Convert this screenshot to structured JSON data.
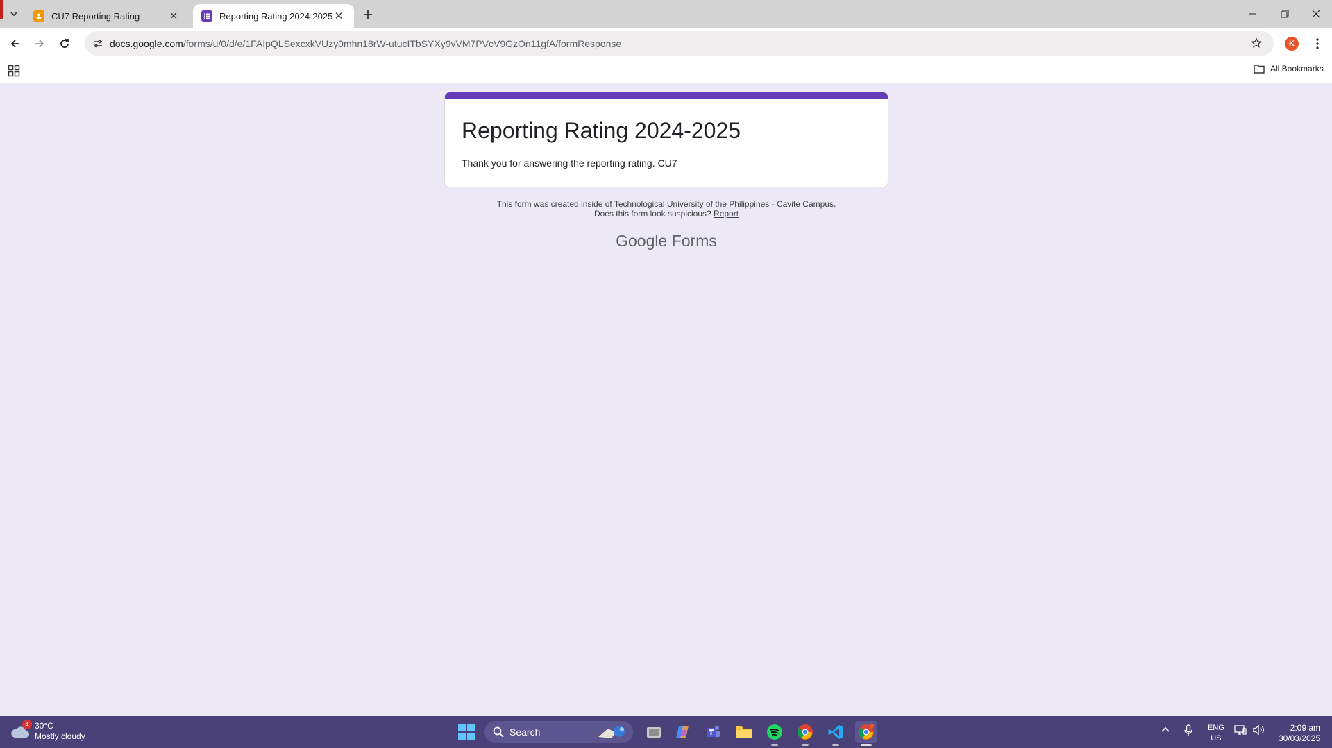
{
  "browser": {
    "tabs": [
      {
        "title": "CU7 Reporting Rating",
        "favicon": "slides-icon",
        "active": false
      },
      {
        "title": "Reporting Rating 2024-2025",
        "favicon": "forms-icon",
        "active": true
      }
    ],
    "url_host": "docs.google.com",
    "url_path": "/forms/u/0/d/e/1FAIpQLSexcxkVUzy0mhn18rW-utucITbSYXy9vVM7PVcV9GzOn11gfA/formResponse",
    "profile_initial": "K",
    "bookmarks_label": "All Bookmarks"
  },
  "form": {
    "title": "Reporting Rating 2024-2025",
    "confirmation": "Thank you for answering the reporting rating. CU7",
    "accent_color": "#673ab7",
    "footer_line1": "This form was created inside of Technological University of the Philippines - Cavite Campus.",
    "footer_line2_prefix": "Does this form look suspicious?",
    "footer_report_link": "Report",
    "brand_google": "Google",
    "brand_forms": "Forms"
  },
  "taskbar": {
    "weather_temp": "30°C",
    "weather_desc": "Mostly cloudy",
    "weather_badge": "4",
    "search_label": "Search",
    "lang_line1": "ENG",
    "lang_line2": "US",
    "time": "2:09 am",
    "date": "30/03/2025"
  }
}
